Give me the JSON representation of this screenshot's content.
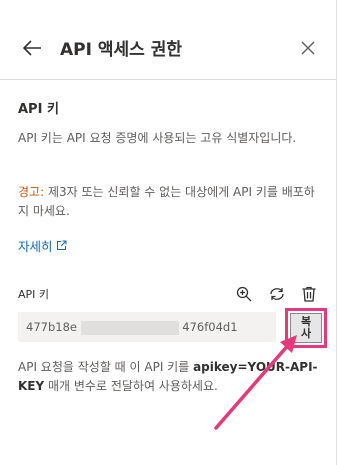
{
  "header": {
    "title": "API 액세스 권한",
    "back_icon": "arrow-left-icon",
    "close_icon": "close-icon"
  },
  "section": {
    "title": "API 키",
    "description": "API 키는 API 요청 증명에 사용되는 고유 식별자입니다.",
    "warning_label": "경고:",
    "warning_text": " 제3자 또는 신뢰할 수 없는 대상에게 API 키를 배포하지 마세요.",
    "learn_more": "자세히"
  },
  "key": {
    "label": "API 키",
    "value_start": "477b18e",
    "value_end": "476f04d1",
    "tools": [
      "zoom-icon",
      "refresh-icon",
      "delete-icon"
    ],
    "copy_top": "복",
    "copy_bottom": "사"
  },
  "footer": {
    "before": "API 요청을 작성할 때 이 API 키를 ",
    "param": "apikey=YOUR-API-KEY",
    "after": " 매개 변수로 전달하여 사용하세요."
  },
  "colors": {
    "accent": "#0f6cbd",
    "warning": "#c55a11",
    "highlight": "#e8377a"
  }
}
